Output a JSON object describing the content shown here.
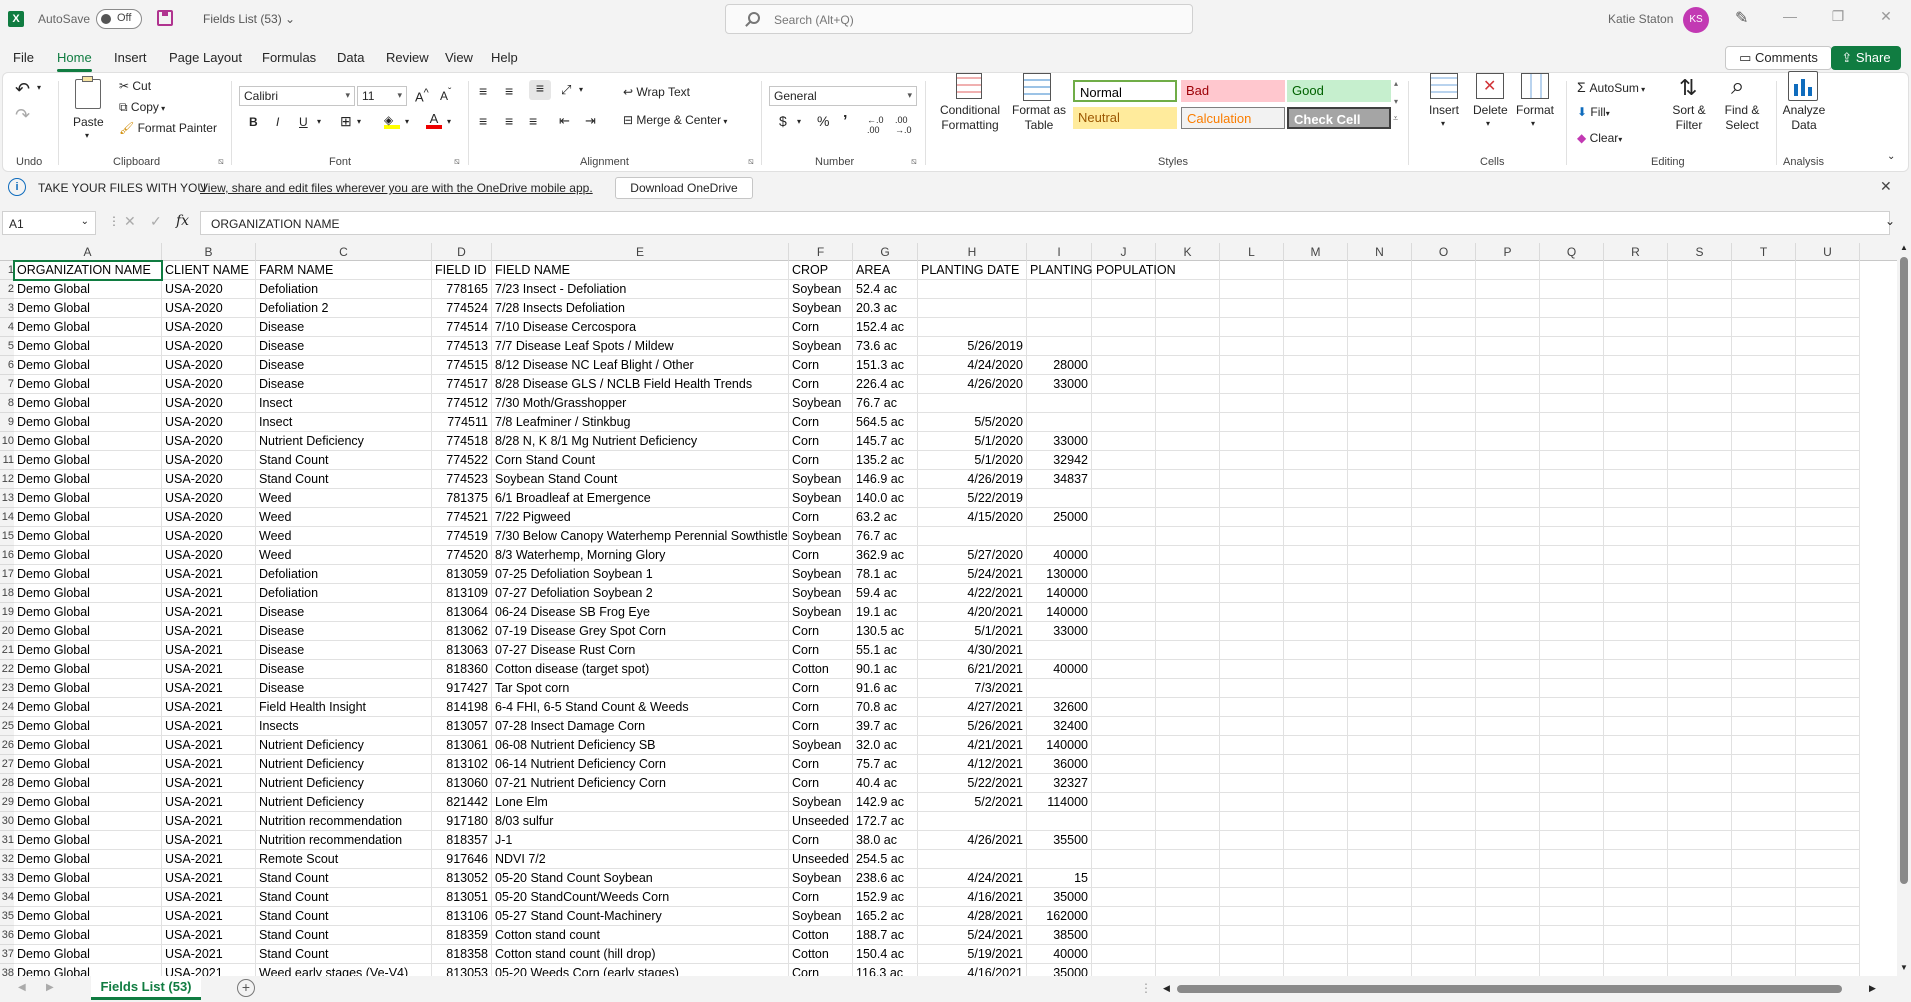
{
  "titlebar": {
    "logo": "X",
    "autosave_label": "AutoSave",
    "autosave_state": "Off",
    "doc_title": "Fields List (53) ⌄",
    "search_placeholder": "Search (Alt+Q)",
    "user_name": "Katie Staton",
    "user_initials": "KS"
  },
  "tabs": [
    "File",
    "Home",
    "Insert",
    "Page Layout",
    "Formulas",
    "Data",
    "Review",
    "View",
    "Help"
  ],
  "active_tab": "Home",
  "header_buttons": {
    "comments": "Comments",
    "share": "Share"
  },
  "ribbon": {
    "undo_group": "Undo",
    "clipboard": {
      "paste": "Paste",
      "cut": "Cut",
      "copy": "Copy",
      "format_painter": "Format Painter",
      "label": "Clipboard"
    },
    "font": {
      "name": "Calibri",
      "size": "11",
      "label": "Font",
      "bold": "B",
      "italic": "I",
      "underline": "U"
    },
    "alignment": {
      "wrap": "Wrap Text",
      "merge": "Merge & Center",
      "label": "Alignment"
    },
    "number": {
      "format": "General",
      "label": "Number",
      "currency": "$",
      "percent": "%",
      "comma": "’"
    },
    "styles": {
      "conditional": "Conditional Formatting",
      "format_table": "Format as Table",
      "cells": [
        {
          "name": "Normal",
          "bg": "#ffffff",
          "fg": "#000000",
          "border": "#70ad47"
        },
        {
          "name": "Bad",
          "bg": "#ffc7ce",
          "fg": "#9c0006",
          "border": "#ffc7ce"
        },
        {
          "name": "Good",
          "bg": "#c6efce",
          "fg": "#006100",
          "border": "#c6efce"
        },
        {
          "name": "Neutral",
          "bg": "#ffeb9c",
          "fg": "#9c5700",
          "border": "#ffeb9c"
        },
        {
          "name": "Calculation",
          "bg": "#f2f2f2",
          "fg": "#fa7d00",
          "border": "#7f7f7f"
        },
        {
          "name": "Check Cell",
          "bg": "#a5a5a5",
          "fg": "#ffffff",
          "border": "#3f3f3f"
        }
      ],
      "label": "Styles"
    },
    "cells": {
      "insert": "Insert",
      "delete": "Delete",
      "format": "Format",
      "label": "Cells"
    },
    "editing": {
      "autosum": "AutoSum",
      "fill": "Fill",
      "clear": "Clear",
      "sort": "Sort & Filter",
      "find": "Find & Select",
      "label": "Editing"
    },
    "analysis": {
      "analyze": "Analyze Data",
      "label": "Analysis"
    }
  },
  "infobar": {
    "title": "TAKE YOUR FILES WITH YOU",
    "link": "View, share and edit files wherever you are with the OneDrive mobile app.",
    "button": "Download OneDrive"
  },
  "formula_bar": {
    "name_box": "A1",
    "fx": "fx",
    "content": "ORGANIZATION NAME"
  },
  "columns": [
    "A",
    "B",
    "C",
    "D",
    "E",
    "F",
    "G",
    "H",
    "I",
    "J",
    "K",
    "L",
    "M",
    "N",
    "O",
    "P",
    "Q",
    "R",
    "S",
    "T",
    "U"
  ],
  "rows": [
    [
      "ORGANIZATION NAME",
      "CLIENT NAME",
      "FARM NAME",
      "FIELD ID",
      "FIELD NAME",
      "CROP",
      "AREA",
      "PLANTING DATE",
      "PLANTING POPULATION"
    ],
    [
      "Demo Global",
      "USA-2020",
      "Defoliation",
      "778165",
      "7/23 Insect - Defoliation",
      "Soybean",
      "52.4 ac",
      "",
      ""
    ],
    [
      "Demo Global",
      "USA-2020",
      "Defoliation 2",
      "774524",
      "7/28 Insects Defoliation",
      "Soybean",
      "20.3 ac",
      "",
      ""
    ],
    [
      "Demo Global",
      "USA-2020",
      "Disease",
      "774514",
      "7/10 Disease Cercospora",
      "Corn",
      "152.4 ac",
      "",
      ""
    ],
    [
      "Demo Global",
      "USA-2020",
      "Disease",
      "774513",
      "7/7 Disease Leaf Spots / Mildew",
      "Soybean",
      "73.6 ac",
      "5/26/2019",
      ""
    ],
    [
      "Demo Global",
      "USA-2020",
      "Disease",
      "774515",
      "8/12 Disease NC Leaf Blight / Other",
      "Corn",
      "151.3 ac",
      "4/24/2020",
      "28000"
    ],
    [
      "Demo Global",
      "USA-2020",
      "Disease",
      "774517",
      "8/28 Disease GLS / NCLB Field Health Trends",
      "Corn",
      "226.4 ac",
      "4/26/2020",
      "33000"
    ],
    [
      "Demo Global",
      "USA-2020",
      "Insect",
      "774512",
      "7/30 Moth/Grasshopper",
      "Soybean",
      "76.7 ac",
      "",
      ""
    ],
    [
      "Demo Global",
      "USA-2020",
      "Insect",
      "774511",
      "7/8 Leafminer / Stinkbug",
      "Corn",
      "564.5 ac",
      "5/5/2020",
      ""
    ],
    [
      "Demo Global",
      "USA-2020",
      "Nutrient Deficiency",
      "774518",
      "8/28 N, K      8/1 Mg    Nutrient Deficiency",
      "Corn",
      "145.7 ac",
      "5/1/2020",
      "33000"
    ],
    [
      "Demo Global",
      "USA-2020",
      "Stand Count",
      "774522",
      "Corn Stand Count",
      "Corn",
      "135.2 ac",
      "5/1/2020",
      "32942"
    ],
    [
      "Demo Global",
      "USA-2020",
      "Stand Count",
      "774523",
      "Soybean Stand Count",
      "Soybean",
      "146.9 ac",
      "4/26/2019",
      "34837"
    ],
    [
      "Demo Global",
      "USA-2020",
      "Weed",
      "781375",
      "6/1 Broadleaf at Emergence",
      "Soybean",
      "140.0 ac",
      "5/22/2019",
      ""
    ],
    [
      "Demo Global",
      "USA-2020",
      "Weed",
      "774521",
      "7/22 Pigweed",
      "Corn",
      "63.2 ac",
      "4/15/2020",
      "25000"
    ],
    [
      "Demo Global",
      "USA-2020",
      "Weed",
      "774519",
      "7/30  Below Canopy Waterhemp Perennial Sowthistle",
      "Soybean",
      "76.7 ac",
      "",
      ""
    ],
    [
      "Demo Global",
      "USA-2020",
      "Weed",
      "774520",
      "8/3 Waterhemp, Morning Glory",
      "Corn",
      "362.9 ac",
      "5/27/2020",
      "40000"
    ],
    [
      "Demo Global",
      "USA-2021",
      "Defoliation",
      "813059",
      "07-25 Defoliation Soybean 1",
      "Soybean",
      "78.1 ac",
      "5/24/2021",
      "130000"
    ],
    [
      "Demo Global",
      "USA-2021",
      "Defoliation",
      "813109",
      "07-27 Defoliation Soybean 2",
      "Soybean",
      "59.4 ac",
      "4/22/2021",
      "140000"
    ],
    [
      "Demo Global",
      "USA-2021",
      "Disease",
      "813064",
      "06-24 Disease SB Frog Eye",
      "Soybean",
      "19.1 ac",
      "4/20/2021",
      "140000"
    ],
    [
      "Demo Global",
      "USA-2021",
      "Disease",
      "813062",
      "07-19 Disease Grey Spot Corn",
      "Corn",
      "130.5 ac",
      "5/1/2021",
      "33000"
    ],
    [
      "Demo Global",
      "USA-2021",
      "Disease",
      "813063",
      "07-27 Disease Rust Corn",
      "Corn",
      "55.1 ac",
      "4/30/2021",
      ""
    ],
    [
      "Demo Global",
      "USA-2021",
      "Disease",
      "818360",
      "Cotton disease (target spot)",
      "Cotton",
      "90.1 ac",
      "6/21/2021",
      "40000"
    ],
    [
      "Demo Global",
      "USA-2021",
      "Disease",
      "917427",
      "Tar Spot corn",
      "Corn",
      "91.6 ac",
      "7/3/2021",
      ""
    ],
    [
      "Demo Global",
      "USA-2021",
      "Field Health Insight",
      "814198",
      "6-4 FHI, 6-5 Stand Count & Weeds",
      "Corn",
      "70.8 ac",
      "4/27/2021",
      "32600"
    ],
    [
      "Demo Global",
      "USA-2021",
      "Insects",
      "813057",
      "07-28 Insect Damage Corn",
      "Corn",
      "39.7 ac",
      "5/26/2021",
      "32400"
    ],
    [
      "Demo Global",
      "USA-2021",
      "Nutrient Deficiency",
      "813061",
      "06-08 Nutrient Deficiency SB",
      "Soybean",
      "32.0 ac",
      "4/21/2021",
      "140000"
    ],
    [
      "Demo Global",
      "USA-2021",
      "Nutrient Deficiency",
      "813102",
      "06-14 Nutrient Deficiency Corn",
      "Corn",
      "75.7 ac",
      "4/12/2021",
      "36000"
    ],
    [
      "Demo Global",
      "USA-2021",
      "Nutrient Deficiency",
      "813060",
      "07-21 Nutrient Deficiency Corn",
      "Corn",
      "40.4 ac",
      "5/22/2021",
      "32327"
    ],
    [
      "Demo Global",
      "USA-2021",
      "Nutrient Deficiency",
      "821442",
      "Lone Elm",
      "Soybean",
      "142.9 ac",
      "5/2/2021",
      "114000"
    ],
    [
      "Demo Global",
      "USA-2021",
      "Nutrition recommendation",
      "917180",
      "8/03 sulfur",
      "Unseeded",
      "172.7 ac",
      "",
      ""
    ],
    [
      "Demo Global",
      "USA-2021",
      "Nutrition recommendation",
      "818357",
      "J-1",
      "Corn",
      "38.0 ac",
      "4/26/2021",
      "35500"
    ],
    [
      "Demo Global",
      "USA-2021",
      "Remote Scout",
      "917646",
      "NDVI 7/2",
      "Unseeded",
      "254.5 ac",
      "",
      ""
    ],
    [
      "Demo Global",
      "USA-2021",
      "Stand Count",
      "813052",
      "05-20 Stand Count Soybean",
      "Soybean",
      "238.6 ac",
      "4/24/2021",
      "15"
    ],
    [
      "Demo Global",
      "USA-2021",
      "Stand Count",
      "813051",
      "05-20 StandCount/Weeds Corn",
      "Corn",
      "152.9 ac",
      "4/16/2021",
      "35000"
    ],
    [
      "Demo Global",
      "USA-2021",
      "Stand Count",
      "813106",
      "05-27 Stand Count-Machinery",
      "Soybean",
      "165.2 ac",
      "4/28/2021",
      "162000"
    ],
    [
      "Demo Global",
      "USA-2021",
      "Stand Count",
      "818359",
      "Cotton stand count",
      "Cotton",
      "188.7 ac",
      "5/24/2021",
      "38500"
    ],
    [
      "Demo Global",
      "USA-2021",
      "Stand Count",
      "818358",
      "Cotton stand count (hill drop)",
      "Cotton",
      "150.4 ac",
      "5/19/2021",
      "40000"
    ],
    [
      "Demo Global",
      "USA-2021",
      "Weed early stages (Ve-V4)",
      "813053",
      "05-20 Weeds Corn (early stages)",
      "Corn",
      "116.3 ac",
      "4/16/2021",
      "35000"
    ]
  ],
  "sheet_tab": "Fields List (53)",
  "accent": "#107c41"
}
